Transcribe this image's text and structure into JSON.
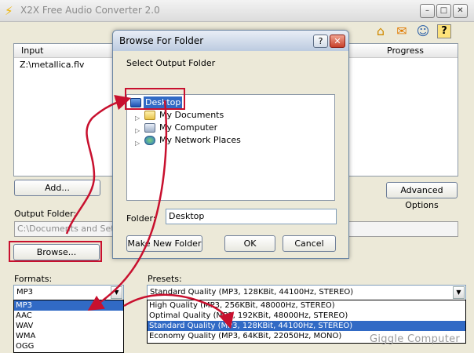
{
  "app": {
    "title": "X2X Free Audio Converter 2.0",
    "window_controls": {
      "minimize": "–",
      "maximize": "□",
      "close": "✕"
    },
    "toolbar": {
      "home_icon": "⌂",
      "mail_icon": "✉",
      "user_icon": "☺",
      "help_icon": "?"
    },
    "file_list": {
      "columns": [
        "Input",
        "Progress"
      ],
      "rows": [
        "Z:\\metallica.flv"
      ]
    },
    "add_button": "Add...",
    "advanced_button": "Advanced Options",
    "output_folder_label": "Output Folder:",
    "output_folder_value": "C:\\Documents and Settings\\",
    "browse_button": "Browse...",
    "formats_label": "Formats:",
    "formats_selected": "MP3",
    "formats_options": [
      "MP3",
      "AAC",
      "WAV",
      "WMA",
      "OGG"
    ],
    "presets_label": "Presets:",
    "presets_selected": "Standard Quality  (MP3, 128KBit, 44100Hz, STEREO)",
    "presets_options": [
      "High Quality  (MP3, 256KBit, 48000Hz, STEREO)",
      "Optimal Quality  (MP3, 192KBit, 48000Hz, STEREO)",
      "Standard Quality  (MP3, 128KBit, 44100Hz, STEREO)",
      "Economy Quality  (MP3, 64KBit, 22050Hz, MONO)"
    ]
  },
  "dialog": {
    "title": "Browse For Folder",
    "help_label": "?",
    "close_label": "✕",
    "instruction": "Select Output Folder",
    "tree": [
      {
        "label": "Desktop",
        "selected": true,
        "icon": "desktop-icon"
      },
      {
        "label": "My Documents",
        "icon": "my-documents-icon"
      },
      {
        "label": "My Computer",
        "icon": "my-computer-icon"
      },
      {
        "label": "My Network Places",
        "icon": "network-places-icon"
      }
    ],
    "folder_label": "Folder:",
    "folder_value": "Desktop",
    "make_new_folder": "Make New Folder",
    "ok": "OK",
    "cancel": "Cancel"
  },
  "watermark": "Giggle Computer",
  "colors": {
    "selection": "#316ac5",
    "annotation": "#c8102e",
    "dialog_close": "#c8412b"
  }
}
